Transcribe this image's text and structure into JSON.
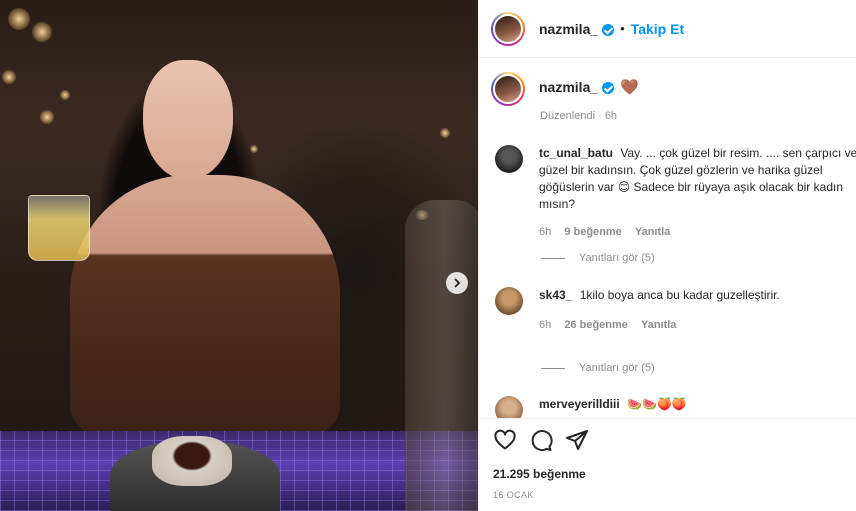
{
  "post": {
    "author": "nazmila_",
    "follow_label": "Takip Et",
    "separator": "•",
    "caption_emoji": "🤎",
    "edited_label": "Düzenlendi · 6h"
  },
  "comments": [
    {
      "user": "tc_unal_batu",
      "text": "Vay. ... çok güzel bir resim. .... sen çarpıcı ve güzel bir kadınsın. Çok güzel gözlerin ve harika güzel göğüslerin var 😊 Sadece bir rüyaya aşık olacak bir kadın mısın?",
      "time": "6h",
      "likes": "9 beğenme",
      "reply": "Yanıtla",
      "view_replies": "Yanıtları gör (5)"
    },
    {
      "user": "sk43_",
      "text": "1kilo boya anca bu kadar guzelleştirir.",
      "time": "6h",
      "likes": "26 beğenme",
      "reply": "Yanıtla",
      "view_replies": "Yanıtları gör (5)"
    },
    {
      "user": "merveyerilldiii",
      "text": "🍉🍉🍑🍑"
    }
  ],
  "footer": {
    "likes": "21.295 beğenme",
    "date": "16 OCAK"
  },
  "icons": {
    "like": "heart-outline-icon",
    "comment": "comment-bubble-icon",
    "share": "paper-plane-icon",
    "next": "chevron-right-icon"
  },
  "colors": {
    "accent": "#0095f6",
    "muted": "#8e8e8e",
    "text": "#262626"
  }
}
